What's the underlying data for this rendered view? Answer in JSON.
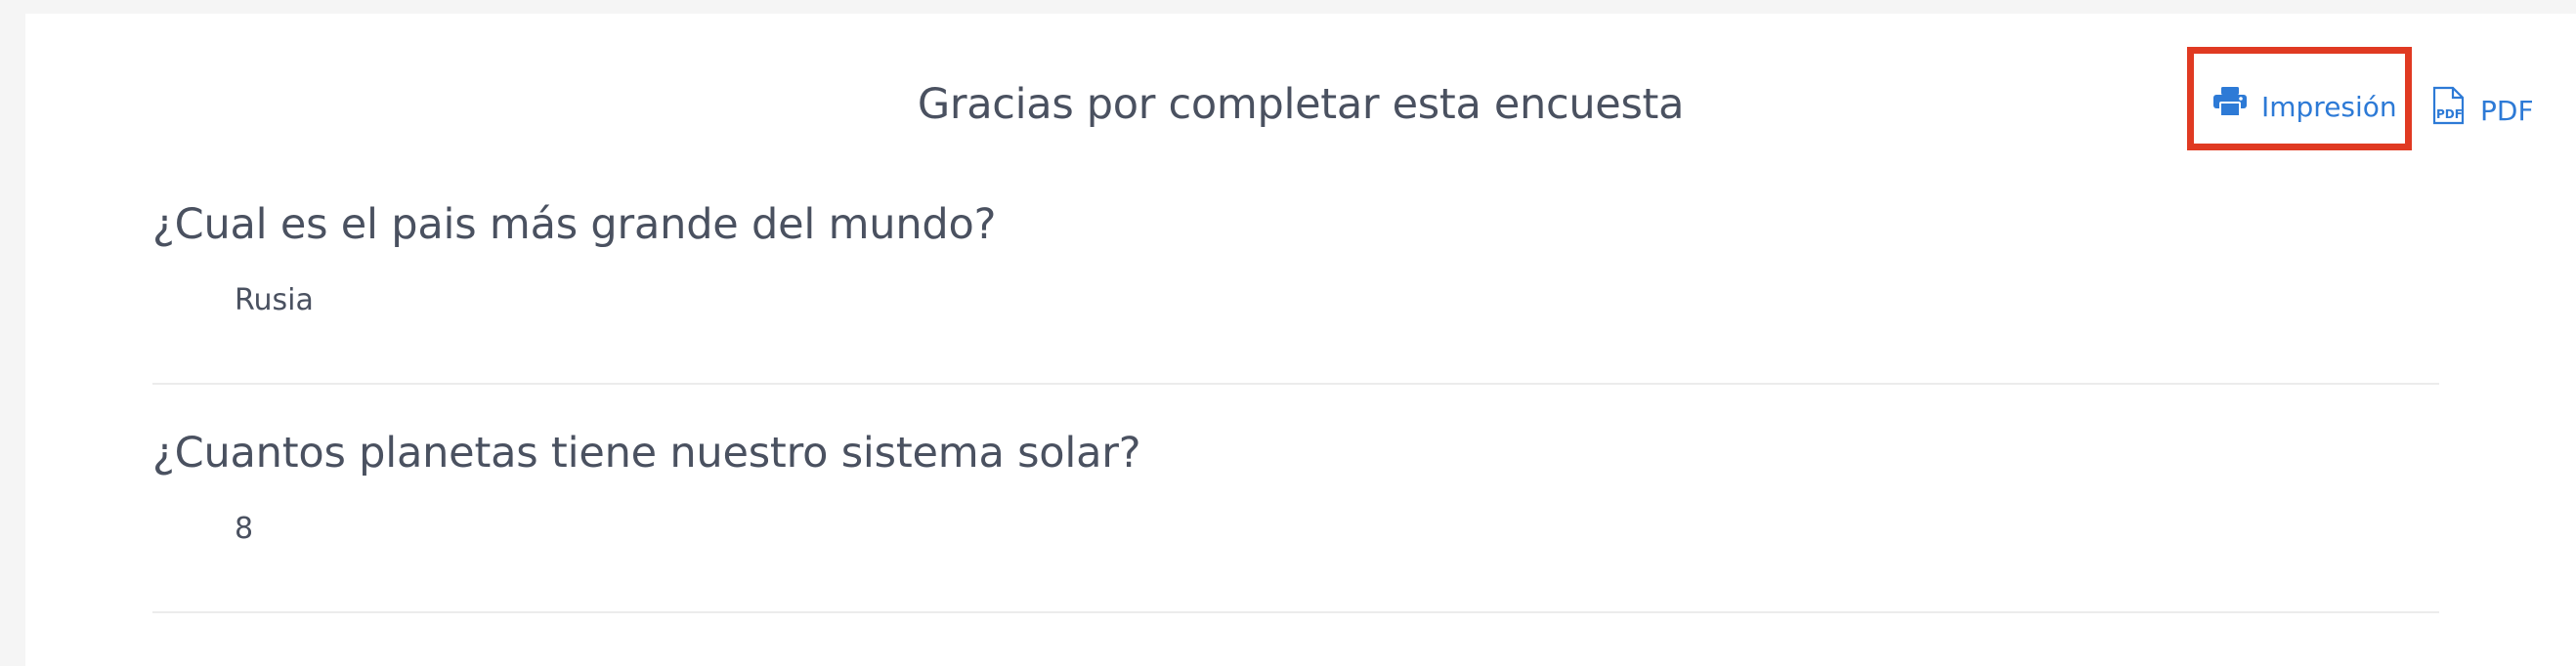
{
  "page": {
    "title": "Gracias por completar esta encuesta"
  },
  "actions": {
    "print_label": "Impresión",
    "pdf_label": "PDF",
    "print_icon": "printer-icon",
    "pdf_icon": "pdf-file-icon",
    "accent_color": "#2d7ad6",
    "highlight_color": "#e03a22"
  },
  "questions": [
    {
      "question": "¿Cual es el pais más grande del mundo?",
      "answer": "Rusia"
    },
    {
      "question": "¿Cuantos planetas tiene nuestro sistema solar?",
      "answer": "8"
    }
  ]
}
